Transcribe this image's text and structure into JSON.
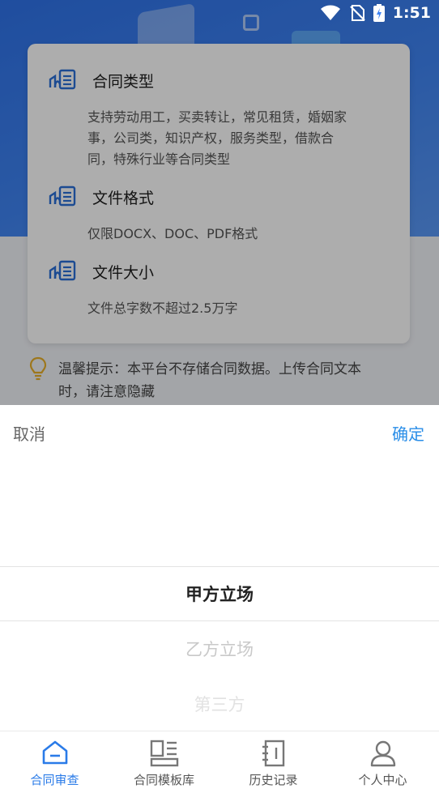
{
  "status_bar": {
    "time": "1:51"
  },
  "upload_info": {
    "sections": [
      {
        "title": "合同类型",
        "lines": [
          "支持劳动用工，买卖转让，常见租赁，婚姻家",
          "事，公司类，知识产权，服务类型，借款合",
          "同，特殊行业等合同类型"
        ]
      },
      {
        "title": "文件格式",
        "lines": [
          "仅限DOCX、DOC、PDF格式"
        ]
      },
      {
        "title": "文件大小",
        "lines": [
          "文件总字数不超过2.5万字"
        ]
      }
    ],
    "tip_lines": [
      "温馨提示：本平台不存储合同数据。上传合同文本",
      "时，请注意隐藏"
    ]
  },
  "picker": {
    "cancel_label": "取消",
    "confirm_label": "确定",
    "options": [
      "甲方立场",
      "乙方立场",
      "第三方"
    ],
    "selected": "甲方立场"
  },
  "tabbar": {
    "tabs": [
      {
        "label": "合同审查",
        "icon": "home-icon",
        "active": true
      },
      {
        "label": "合同模板库",
        "icon": "template-grid-icon",
        "active": false
      },
      {
        "label": "历史记录",
        "icon": "history-notebook-icon",
        "active": false
      },
      {
        "label": "个人中心",
        "icon": "person-icon",
        "active": false
      }
    ]
  },
  "colors": {
    "accent": "#2a7be8",
    "confirm": "#2a8ee8",
    "hero": "#3f84f3"
  }
}
